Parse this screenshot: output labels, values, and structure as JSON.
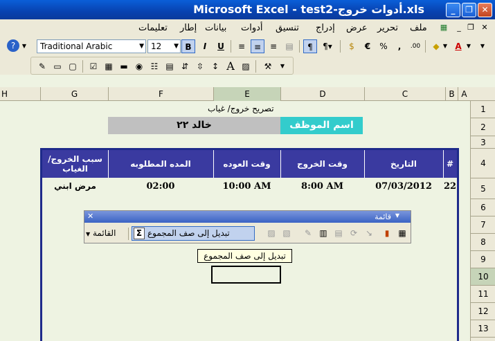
{
  "window": {
    "title": "Microsoft Excel - test2-أدوات خروج.xls"
  },
  "menu": {
    "items": [
      "ملف",
      "تحرير",
      "عرض",
      "إدراج",
      "تنسيق",
      "أدوات",
      "بيانات",
      "إطار",
      "تعليمات"
    ]
  },
  "toolbar": {
    "font_name": "Traditional Arabic",
    "font_size": "12",
    "bold": "B",
    "italic": "I",
    "underline": "U",
    "currency": "€",
    "percent": "%",
    "comma": ",",
    "decimals": ".00",
    "font_color": "A"
  },
  "columns": [
    "A",
    "B",
    "C",
    "D",
    "E",
    "F",
    "G",
    "H"
  ],
  "rows": [
    "1",
    "2",
    "3",
    "4",
    "5",
    "6",
    "7",
    "8",
    "9",
    "10",
    "11",
    "12",
    "13"
  ],
  "active_column": "E",
  "active_row": "10",
  "sheet": {
    "permit_title": "تصريح خروج/ غياب",
    "employee_label": "اسم الموظف",
    "employee_name": "خالد ٢٢",
    "headers": {
      "num": "#",
      "date": "التاريخ",
      "exit_time": "وقت الخروج",
      "return_time": "وقت العوده",
      "duration": "المده المطلوبه",
      "reason": "سبب الخروج/الغياب"
    },
    "record": {
      "num": "22",
      "date": "07/03/2012",
      "exit_time": "8:00 AM",
      "return_time": "10:00 AM",
      "duration": "02:00",
      "reason": "مرض ابني"
    }
  },
  "floating_toolbar": {
    "title": "قائمة",
    "menu_label": "القائمة",
    "convert_button": "تبديل إلى صف المجموع",
    "sigma": "Σ"
  },
  "tooltip": {
    "text": "تبديل إلى صف المجموع"
  }
}
